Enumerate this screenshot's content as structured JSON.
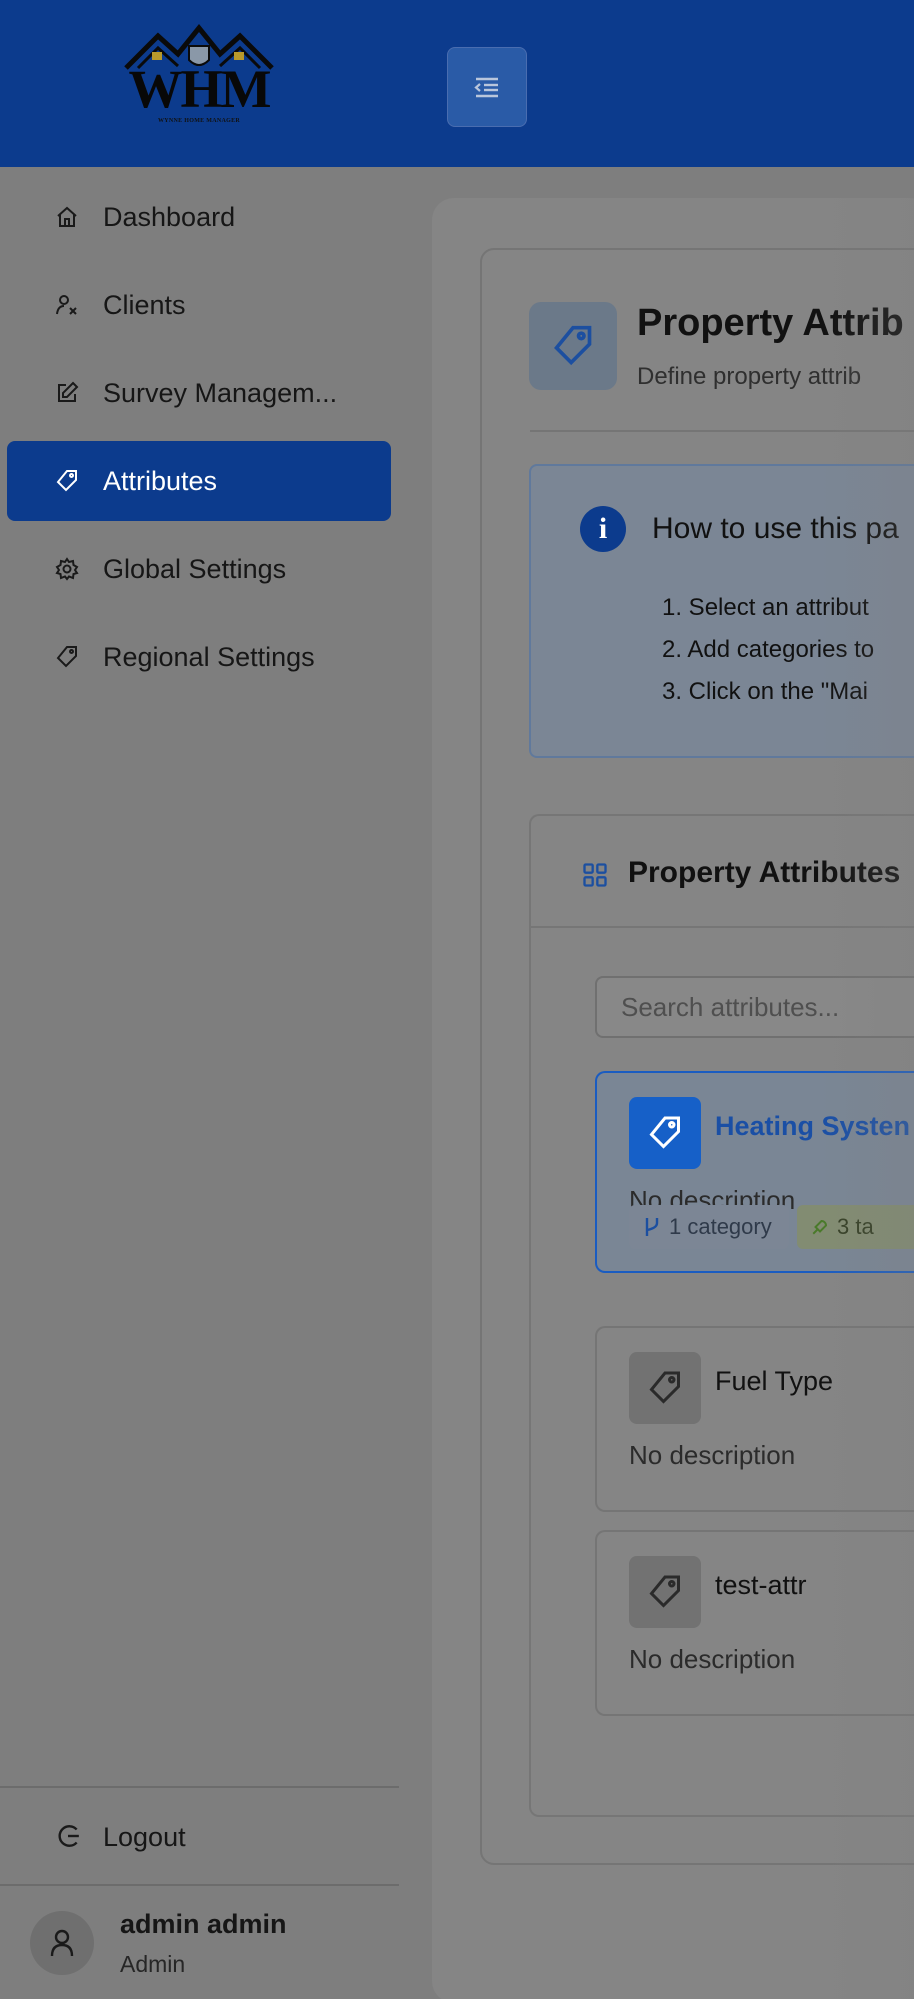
{
  "brand": {
    "wordmark": "WHM",
    "tagline": "WYNNE HOME MANAGER"
  },
  "header": {
    "menu_toggle_icon": "menu-collapse-icon"
  },
  "sidebar": {
    "items": [
      {
        "label": "Dashboard",
        "icon": "home-icon"
      },
      {
        "label": "Clients",
        "icon": "users-icon"
      },
      {
        "label": "Survey Managem...",
        "icon": "edit-icon"
      },
      {
        "label": "Attributes",
        "icon": "tag-icon",
        "active": true
      },
      {
        "label": "Global Settings",
        "icon": "gear-icon"
      },
      {
        "label": "Regional Settings",
        "icon": "tag-icon"
      }
    ],
    "logout_label": "Logout",
    "user": {
      "name": "admin admin",
      "role": "Admin"
    }
  },
  "main": {
    "title": "Property Attrib",
    "subtitle": "Define property attrib",
    "info": {
      "title": "How to use this pa",
      "steps": [
        "1. Select an attribut",
        "2. Add categories to",
        "3. Click on the \"Mai"
      ]
    },
    "list": {
      "title": "Property Attributes",
      "search_placeholder": "Search attributes...",
      "attributes": [
        {
          "name": "Heating Systen",
          "description": "No description",
          "categories": "1 category",
          "tags": "3 ta",
          "selected": true
        },
        {
          "name": "Fuel Type",
          "description": "No description"
        },
        {
          "name": "test-attr",
          "description": "No description"
        }
      ]
    }
  },
  "colors": {
    "brand_blue": "#0c3b8d",
    "selected_border": "#1a5cc1",
    "overlay_gray": "#7e7e7e"
  }
}
